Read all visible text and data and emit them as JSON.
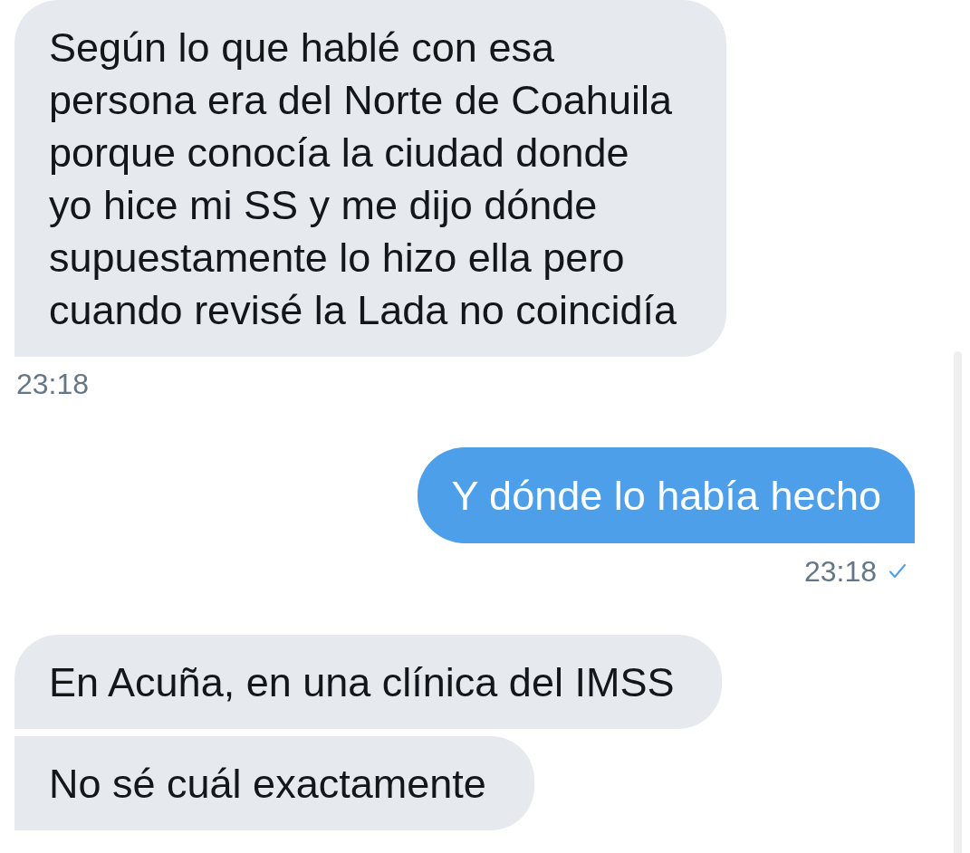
{
  "conversation": [
    {
      "kind": "incoming",
      "text": "Según lo que hablé con esa persona era del Norte de Coahuila porque conocía la ciudad donde yo hice mi SS y me dijo dónde supuestamente lo hizo ella pero cuando revisé la Lada no coincidía",
      "time": "23:18"
    },
    {
      "kind": "outgoing",
      "text": "Y dónde lo había hecho",
      "time": "23:18",
      "delivered": true
    },
    {
      "kind": "incoming",
      "text": "En Acuña, en una clínica del IMSS"
    },
    {
      "kind": "incoming",
      "text": "No sé cuál exactamente"
    }
  ]
}
